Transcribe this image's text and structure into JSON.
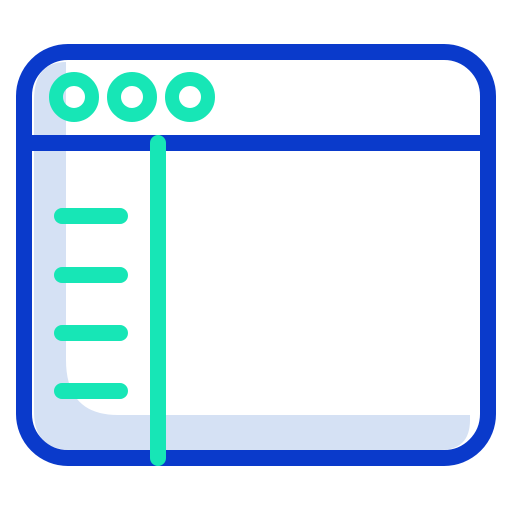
{
  "icon": {
    "name": "browser-window-sidebar-icon",
    "colors": {
      "outline": "#0a3acb",
      "accent": "#17e6b6",
      "shadow": "#d5e1f4",
      "background": "#ffffff"
    },
    "title_bar": {
      "dot_count": 3
    },
    "sidebar": {
      "line_count": 4
    }
  }
}
